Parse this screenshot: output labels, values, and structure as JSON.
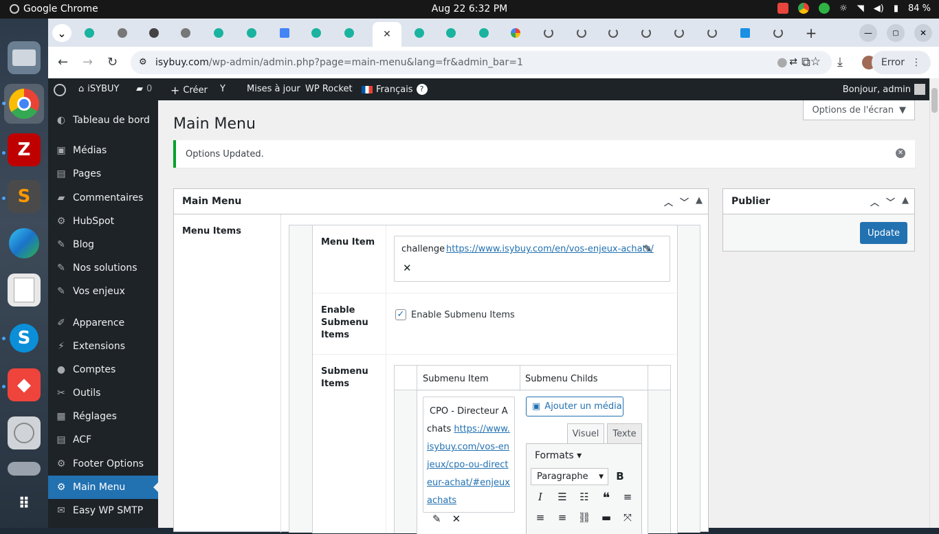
{
  "os": {
    "app_name": "Google Chrome",
    "datetime": "Aug 22  6:32 PM",
    "battery": "84 %"
  },
  "browser": {
    "url_host": "isybuy.com",
    "url_path": "/wp-admin/admin.php?page=main-menu&lang=fr&admin_bar=1",
    "error_label": "Error"
  },
  "wpbar": {
    "site": "iSYBUY",
    "comments": "0",
    "create": "Créer",
    "updates": "Mises à jour",
    "rocket": "WP Rocket",
    "lang": "Français",
    "greeting": "Bonjour, admin"
  },
  "sidebar": {
    "items": [
      {
        "label": "Tableau de bord",
        "icon": "dashboard-icon"
      },
      {
        "label": "Médias",
        "icon": "media-icon"
      },
      {
        "label": "Pages",
        "icon": "pages-icon"
      },
      {
        "label": "Commentaires",
        "icon": "comments-icon"
      },
      {
        "label": "HubSpot",
        "icon": "hubspot-icon"
      },
      {
        "label": "Blog",
        "icon": "pin-icon"
      },
      {
        "label": "Nos solutions",
        "icon": "pin-icon"
      },
      {
        "label": "Vos enjeux",
        "icon": "pin-icon"
      },
      {
        "label": "Apparence",
        "icon": "brush-icon"
      },
      {
        "label": "Extensions",
        "icon": "plugin-icon"
      },
      {
        "label": "Comptes",
        "icon": "user-icon"
      },
      {
        "label": "Outils",
        "icon": "wrench-icon"
      },
      {
        "label": "Réglages",
        "icon": "settings-icon"
      },
      {
        "label": "ACF",
        "icon": "acf-icon"
      },
      {
        "label": "Footer Options",
        "icon": "gear-icon"
      },
      {
        "label": "Main Menu",
        "icon": "gear-icon"
      },
      {
        "label": "Easy WP SMTP",
        "icon": "mail-icon"
      }
    ]
  },
  "page": {
    "screen_options": "Options de l'écran",
    "title": "Main Menu",
    "notice": "Options Updated.",
    "box_title": "Main Menu",
    "menu_items_label": "Menu Items",
    "menu_item_label": "Menu Item",
    "menu_item_name": "challenge",
    "menu_item_url": "https://www.isybuy.com/en/vos-enjeux-achats/",
    "enable_label": "Enable Submenu Items",
    "enable_checkbox_label": "Enable Submenu Items",
    "submenu_label": "Submenu Items",
    "col_item": "Submenu Item",
    "col_childs": "Submenu Childs",
    "sub_name": "CPO - Directeur Achats",
    "sub_url": "https://www.isybuy.com/vos-enjeux/cpo-ou-directeur-achat/#enjeuxachats",
    "add_media": "Ajouter un média",
    "tab_visual": "Visuel",
    "tab_text": "Texte",
    "formats": "Formats",
    "paragraph": "Paragraphe"
  },
  "publish": {
    "title": "Publier",
    "update": "Update"
  }
}
